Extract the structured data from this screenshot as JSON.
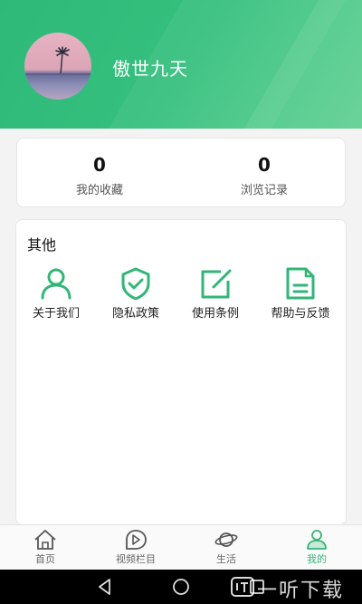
{
  "profile": {
    "username": "傲世九天"
  },
  "stats": [
    {
      "value": "0",
      "label": "我的收藏"
    },
    {
      "value": "0",
      "label": "浏览记录"
    }
  ],
  "other": {
    "title": "其他",
    "items": [
      {
        "label": "关于我们",
        "icon": "person-icon"
      },
      {
        "label": "隐私政策",
        "icon": "shield-check-icon"
      },
      {
        "label": "使用条例",
        "icon": "edit-square-icon"
      },
      {
        "label": "帮助与反馈",
        "icon": "document-icon"
      }
    ]
  },
  "tabbar": {
    "items": [
      {
        "label": "首页",
        "icon": "home-icon"
      },
      {
        "label": "视频栏目",
        "icon": "video-play-icon"
      },
      {
        "label": "生活",
        "icon": "planet-icon"
      },
      {
        "label": "我的",
        "icon": "user-icon"
      }
    ],
    "active_index": 3
  },
  "watermark": {
    "text": "一听下载"
  },
  "colors": {
    "accent": "#32b677",
    "header_start": "#2fb979",
    "header_end": "#5fd091"
  }
}
